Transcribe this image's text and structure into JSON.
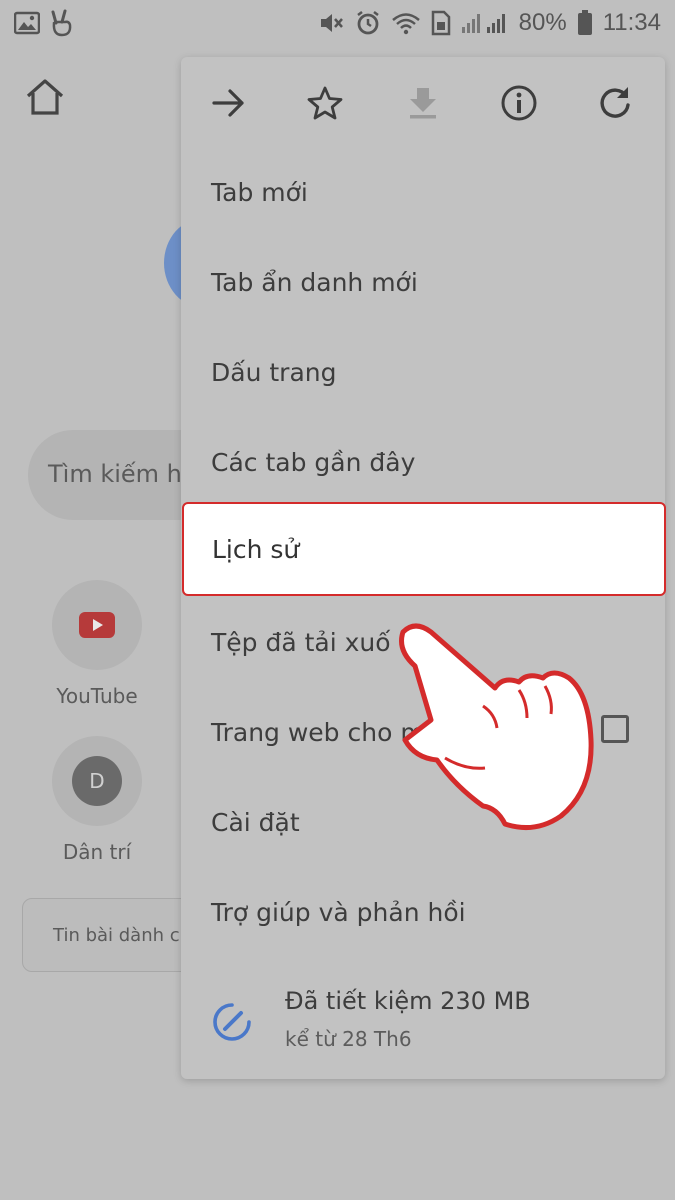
{
  "status_bar": {
    "battery": "80%",
    "time": "11:34",
    "icons": [
      "image-icon",
      "victory-hand-icon",
      "mute-icon",
      "alarm-icon",
      "wifi-icon",
      "sim-icon",
      "signal-icon",
      "battery-icon"
    ]
  },
  "background": {
    "search_placeholder": "Tìm kiếm h",
    "tiles": [
      {
        "label": "YouTube",
        "icon": "youtube-icon"
      },
      {
        "label": "Dân trí",
        "icon": "dantri-icon",
        "letter": "D"
      }
    ],
    "articles_label": "Tin bài dành c"
  },
  "menu": {
    "toolbar": [
      {
        "name": "forward-icon"
      },
      {
        "name": "bookmark-star-icon"
      },
      {
        "name": "download-icon"
      },
      {
        "name": "info-icon"
      },
      {
        "name": "reload-icon"
      }
    ],
    "items": [
      {
        "label": "Tab mới"
      },
      {
        "label": "Tab ẩn danh mới"
      },
      {
        "label": "Dấu trang"
      },
      {
        "label": "Các tab gần đây"
      },
      {
        "label": "Lịch sử"
      },
      {
        "label": "Tệp đã tải xuố"
      },
      {
        "label": "Trang web cho m"
      },
      {
        "label": "Cài đặt"
      },
      {
        "label": "Trợ giúp và phản hồi"
      }
    ],
    "savings_title": "Đã tiết kiệm 230 MB",
    "savings_subtitle": "kể từ 28 Th6"
  },
  "colors": {
    "highlight_border": "#d42b2b",
    "savings_icon": "#4a78c9",
    "youtube_red": "#b63a3a"
  }
}
